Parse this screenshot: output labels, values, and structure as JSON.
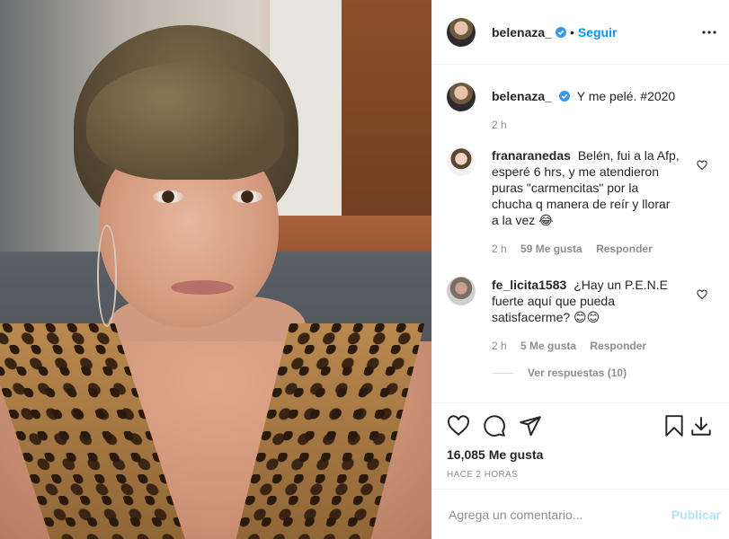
{
  "post": {
    "author": "belenaza_",
    "follow_label": "Seguir",
    "separator": "•",
    "more_icon": "more-horizontal-icon",
    "verified_icon": "verified-badge-icon",
    "accent_color": "#0095f6"
  },
  "caption": {
    "user": "belenaza_",
    "text": "Y me pelé. #2020",
    "time": "2 h"
  },
  "comments": [
    {
      "user": "franaranedas",
      "text": "Belén, fui a la Afp, esperé 6 hrs, y me atendieron puras \"carmencitas\" por la chucha q manera de reír y llorar a la vez 😂",
      "time": "2 h",
      "likes": "59 Me gusta",
      "reply": "Responder"
    },
    {
      "user": "fe_licita1583",
      "text": "¿Hay un P.E.N.E fuerte aquí que pueda satisfacerme? 😊😊",
      "time": "2 h",
      "likes": "5 Me gusta",
      "reply": "Responder"
    }
  ],
  "view_replies": "Ver respuestas (10)",
  "actions": {
    "icons": [
      "heart-icon",
      "comment-icon",
      "share-icon",
      "bookmark-icon",
      "download-icon"
    ],
    "likes": "16,085 Me gusta",
    "posted_ago": "HACE 2 HORAS"
  },
  "add_comment": {
    "placeholder": "Agrega un comentario...",
    "publish_label": "Publicar"
  }
}
